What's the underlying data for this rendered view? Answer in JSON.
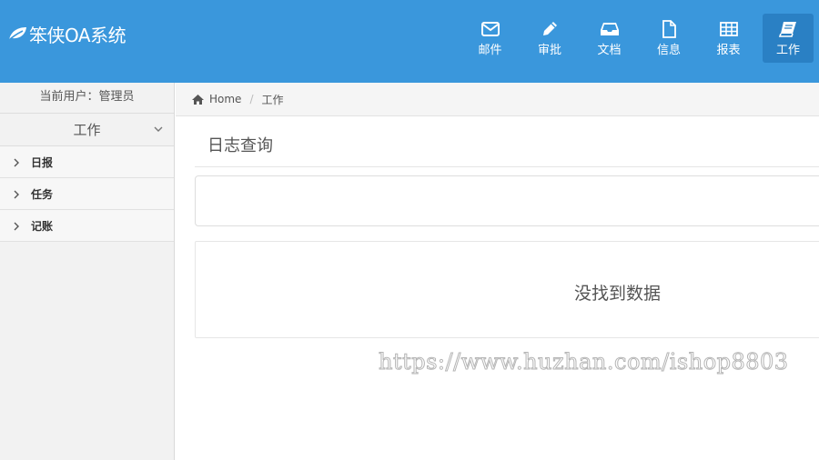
{
  "brand": {
    "name": "笨侠OA系统",
    "icon": "leaf-icon"
  },
  "nav": [
    {
      "label": "邮件",
      "icon": "envelope-icon",
      "active": false
    },
    {
      "label": "审批",
      "icon": "pencil-icon",
      "active": false
    },
    {
      "label": "文档",
      "icon": "inbox-icon",
      "active": false
    },
    {
      "label": "信息",
      "icon": "file-icon",
      "active": false
    },
    {
      "label": "报表",
      "icon": "table-icon",
      "active": false
    },
    {
      "label": "工作",
      "icon": "book-icon",
      "active": true
    }
  ],
  "sidebar": {
    "current_user": "当前用户：管理员",
    "menu_title": "工作",
    "items": [
      {
        "label": "日报"
      },
      {
        "label": "任务"
      },
      {
        "label": "记账"
      }
    ]
  },
  "breadcrumb": {
    "home": "Home",
    "separator": "/",
    "current": "工作"
  },
  "main": {
    "title": "日志查询",
    "empty_message": "没找到数据"
  },
  "watermark": "https://www.huzhan.com/ishop8803",
  "colors": {
    "header": "#3a97dc",
    "nav_active": "#2a80c4",
    "sidebar": "#f2f2f2"
  }
}
